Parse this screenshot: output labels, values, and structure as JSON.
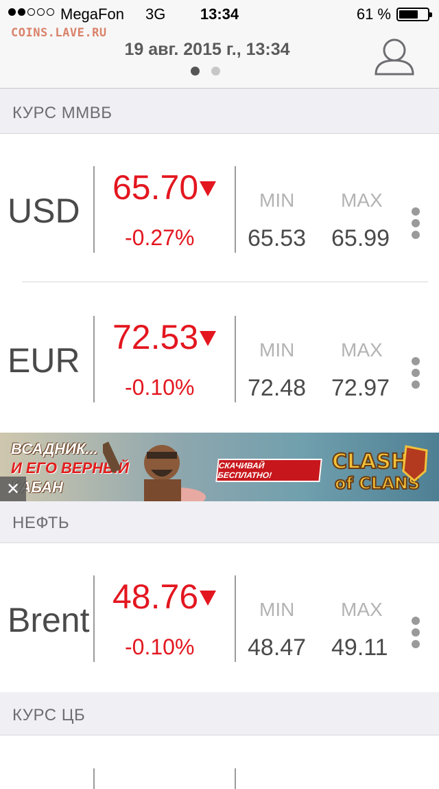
{
  "status_bar": {
    "signal_bars_filled": 2,
    "signal_bars_total": 5,
    "carrier": "MegaFon",
    "network": "3G",
    "time": "13:34",
    "battery_percent": "61 %",
    "battery_level": 0.61
  },
  "watermark": "COINS.LAVE.RU",
  "header": {
    "date": "19 авг. 2015 г., 13:34",
    "page_count": 2,
    "active_page": 0,
    "user_icon": "user-icon"
  },
  "colors": {
    "negative": "#e3161f",
    "section_bg": "#efeff4"
  },
  "sections": {
    "mmvb": {
      "title": "КУРС ММВБ",
      "rows": [
        {
          "currency": "USD",
          "price": "65.70",
          "change": "-0.27%",
          "min_label": "MIN",
          "max_label": "MAX",
          "min": "65.53",
          "max": "65.99",
          "trend": "down"
        },
        {
          "currency": "EUR",
          "price": "72.53",
          "change": "-0.10%",
          "min_label": "MIN",
          "max_label": "MAX",
          "min": "72.48",
          "max": "72.97",
          "trend": "down"
        }
      ]
    },
    "oil": {
      "title": "НЕФТЬ",
      "rows": [
        {
          "currency": "Brent",
          "price": "48.76",
          "change": "-0.10%",
          "min_label": "MIN",
          "max_label": "MAX",
          "min": "48.47",
          "max": "49.11",
          "trend": "down"
        }
      ]
    },
    "cb": {
      "title": "КУРС ЦБ"
    }
  },
  "ad_banner": {
    "line1": "ВСАДНИК...",
    "line2": "И ЕГО ВЕРНЫЙ",
    "line3": "КАБАН",
    "cta": "СКАЧИВАЙ БЕСПЛАТНО!",
    "logo_line1": "CLASH",
    "logo_line2": "of CLANS",
    "close_icon": "close-icon"
  }
}
